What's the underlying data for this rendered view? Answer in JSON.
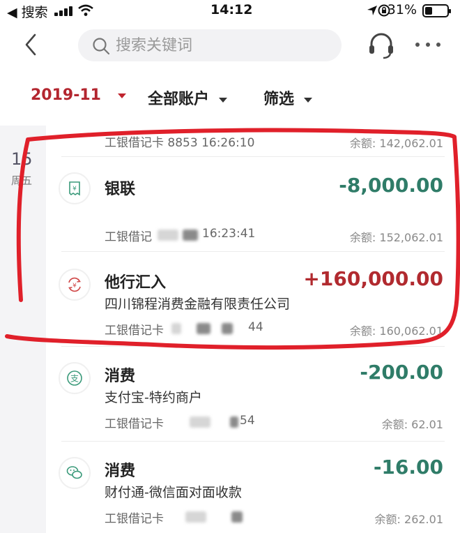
{
  "status_bar": {
    "back_label": "◀ 搜索",
    "time": "14:12",
    "battery": "31%"
  },
  "nav": {
    "search_placeholder": "搜索关键词"
  },
  "filters": {
    "month": "2019-11",
    "account": "全部账户",
    "screen": "筛选"
  },
  "day": {
    "number": "15",
    "weekday": "周五"
  },
  "transactions": [
    {
      "title": "",
      "amount": "",
      "card": "工银借记卡 8853 16:26:10",
      "balance": "余额: 142,062.01"
    },
    {
      "title": "银联",
      "amount": "-8,000.00",
      "card": "工银借记",
      "card_time": "16:23:41",
      "balance": "余额: 152,062.01",
      "icon": "receipt-yen-icon"
    },
    {
      "title": "他行汇入",
      "subtitle": "四川锦程消费金融有限责任公司",
      "amount": "+160,000.00",
      "card": "工银借记卡",
      "card_tail": "44",
      "balance": "余额: 160,062.01",
      "icon": "transfer-yen-icon"
    },
    {
      "title": "消费",
      "subtitle": "支付宝-特约商户",
      "amount": "-200.00",
      "card": "工银借记卡",
      "card_tail": "54",
      "balance": "余额: 62.01",
      "icon": "alipay-icon"
    },
    {
      "title": "消费",
      "subtitle": "财付通-微信面对面收款",
      "amount": "-16.00",
      "card": "工银借记卡",
      "balance": "余额: 262.01",
      "icon": "wechat-icon"
    }
  ],
  "colors": {
    "negative": "#2f7c68",
    "positive": "#b12a2f",
    "accent": "#c0242e",
    "annotation": "#e0202a"
  }
}
